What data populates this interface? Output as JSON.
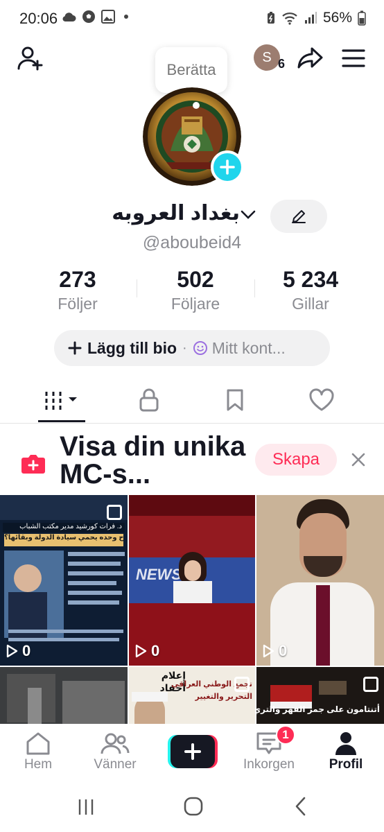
{
  "status_bar": {
    "time": "20:06",
    "battery": "56%"
  },
  "story_bubble": "Berätta",
  "visitors": {
    "initial": "S",
    "count": "6"
  },
  "profile": {
    "display_name": "بغداد العروبه",
    "username": "@aboubeid4",
    "stats": [
      {
        "value": "273",
        "label": "Följer"
      },
      {
        "value": "502",
        "label": "Följare"
      },
      {
        "value": "5 234",
        "label": "Gillar"
      }
    ],
    "bio_add": "Lägg till bio",
    "bio_mc": "Mitt kont..."
  },
  "tabs": [
    {
      "icon": "grid-icon",
      "active": true
    },
    {
      "icon": "lock-icon",
      "active": false
    },
    {
      "icon": "bookmark-icon",
      "active": false
    },
    {
      "icon": "heart-icon",
      "active": false
    }
  ],
  "promo": {
    "text": "Visa din unika MC-s...",
    "create": "Skapa"
  },
  "videos": [
    {
      "views": "0",
      "label_1": "د. فرات كورشيد مدير مكتب الشباب",
      "label_2": "هل السلاح وحده يحمي سيادة الدولة وبقائها؟"
    },
    {
      "views": "0",
      "label_1": "NEWS"
    },
    {
      "views": "0"
    },
    {
      "label_1": "إعلام",
      "label_2": "أحفاد",
      "label_3": "تجمع الوطني العراقي",
      "label_4": "التحرير والتغيير"
    },
    {
      "label_1": "أتنتامون على جمر القهر والتري"
    }
  ],
  "bottom_nav": {
    "home": "Hem",
    "friends": "Vänner",
    "inbox": "Inkorgen",
    "inbox_badge": "1",
    "profile": "Profil"
  },
  "colors": {
    "accent": "#fe2c55",
    "cyan": "#20d5ec",
    "muted": "#8a8b91"
  }
}
